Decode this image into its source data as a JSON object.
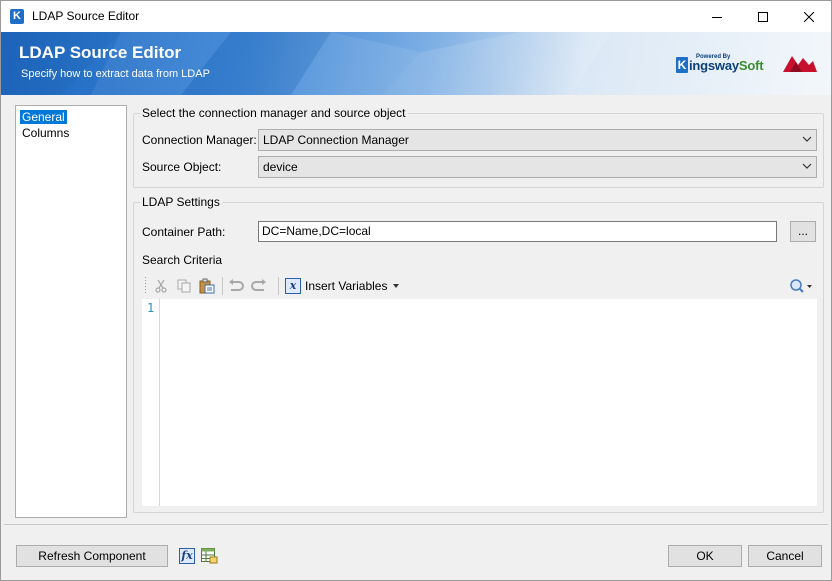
{
  "window": {
    "title": "LDAP Source Editor",
    "icon": "kingswaysoft-k-icon",
    "controls": [
      "minimize-icon",
      "maximize-icon",
      "close-icon"
    ]
  },
  "banner": {
    "title": "LDAP Source Editor",
    "subtitle": "Specify how to extract data from LDAP",
    "brand": {
      "powered_by": "Powered By",
      "k_letter": "K",
      "name_main": "ingsway",
      "name_soft": "Soft"
    }
  },
  "nav": {
    "items": [
      {
        "label": "General",
        "selected": true
      },
      {
        "label": "Columns",
        "selected": false
      }
    ]
  },
  "connection_group": {
    "label": "Select the connection manager and source object",
    "connection_manager_label": "Connection Manager:",
    "connection_manager_value": "LDAP Connection Manager",
    "source_object_label": "Source Object:",
    "source_object_value": "device"
  },
  "ldap_group": {
    "label": "LDAP Settings",
    "container_path_label": "Container Path:",
    "container_path_value": "DC=Name,DC=local",
    "browse_label": "...",
    "search_criteria_label": "Search Criteria"
  },
  "editor": {
    "toolbar": {
      "icons": [
        "cut-icon",
        "copy-icon",
        "paste-icon",
        "undo-icon",
        "redo-icon",
        "search-icon"
      ],
      "insert_variables_label": "Insert Variables",
      "fx_glyph": "x"
    },
    "line_numbers": [
      "1"
    ],
    "content": ""
  },
  "footer": {
    "refresh_label": "Refresh Component",
    "fx_glyph": "fx",
    "ok_label": "OK",
    "cancel_label": "Cancel"
  },
  "colors": {
    "accent": "#0078d7",
    "banner_start": "#1d67c0",
    "line_number": "#2b91af",
    "brand_blue": "#0d3f7a",
    "brand_green": "#3c8f2f",
    "logo_red": "#c8102e"
  }
}
